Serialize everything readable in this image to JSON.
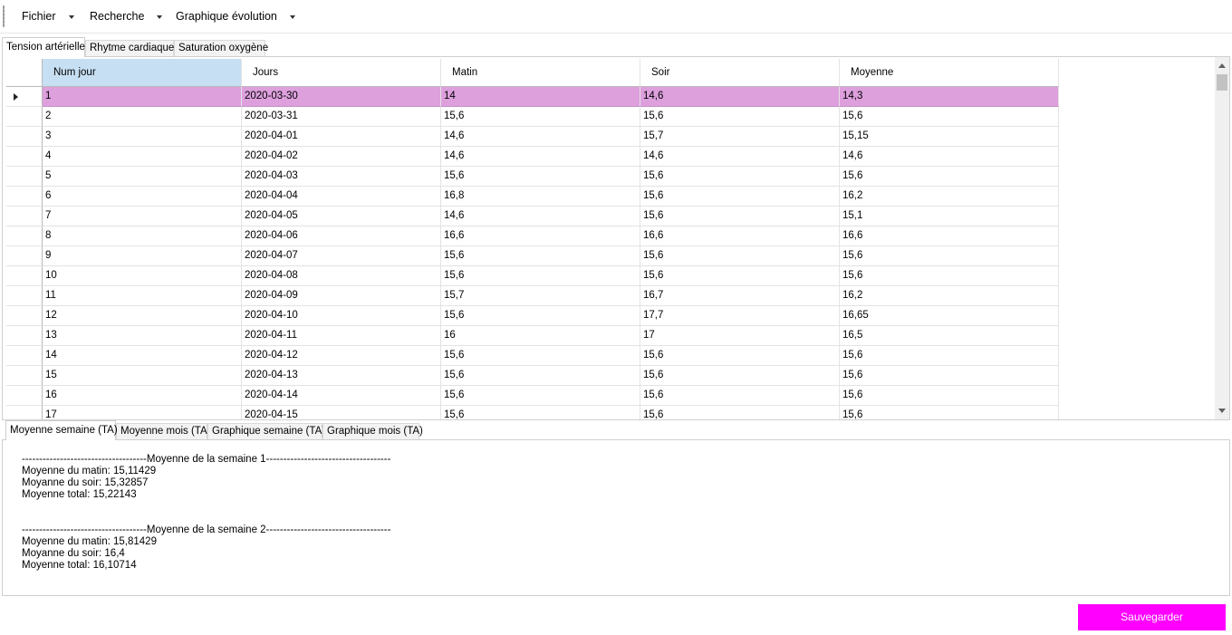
{
  "menu": {
    "items": [
      {
        "label": "Fichier"
      },
      {
        "label": "Recherche"
      },
      {
        "label": "Graphique évolution"
      }
    ]
  },
  "top_tabs": [
    {
      "label": "Tension artérielle",
      "active": true
    },
    {
      "label": "Rhytme cardiaque",
      "active": false
    },
    {
      "label": "Saturation oxygène",
      "active": false
    }
  ],
  "grid": {
    "columns": [
      "Num jour",
      "Jours",
      "Matin",
      "Soir",
      "Moyenne"
    ],
    "selected_column": "Num jour",
    "selected_row": 1,
    "rows": [
      [
        "1",
        "2020-03-30",
        "14",
        "14,6",
        "14,3"
      ],
      [
        "2",
        "2020-03-31",
        "15,6",
        "15,6",
        "15,6"
      ],
      [
        "3",
        "2020-04-01",
        "14,6",
        "15,7",
        "15,15"
      ],
      [
        "4",
        "2020-04-02",
        "14,6",
        "14,6",
        "14,6"
      ],
      [
        "5",
        "2020-04-03",
        "15,6",
        "15,6",
        "15,6"
      ],
      [
        "6",
        "2020-04-04",
        "16,8",
        "15,6",
        "16,2"
      ],
      [
        "7",
        "2020-04-05",
        "14,6",
        "15,6",
        "15,1"
      ],
      [
        "8",
        "2020-04-06",
        "16,6",
        "16,6",
        "16,6"
      ],
      [
        "9",
        "2020-04-07",
        "15,6",
        "15,6",
        "15,6"
      ],
      [
        "10",
        "2020-04-08",
        "15,6",
        "15,6",
        "15,6"
      ],
      [
        "11",
        "2020-04-09",
        "15,7",
        "16,7",
        "16,2"
      ],
      [
        "12",
        "2020-04-10",
        "15,6",
        "17,7",
        "16,65"
      ],
      [
        "13",
        "2020-04-11",
        "16",
        "17",
        "16,5"
      ],
      [
        "14",
        "2020-04-12",
        "15,6",
        "15,6",
        "15,6"
      ],
      [
        "15",
        "2020-04-13",
        "15,6",
        "15,6",
        "15,6"
      ],
      [
        "16",
        "2020-04-14",
        "15,6",
        "15,6",
        "15,6"
      ],
      [
        "17",
        "2020-04-15",
        "15,6",
        "15,6",
        "15,6"
      ]
    ]
  },
  "bottom_tabs": [
    {
      "label": "Moyenne semaine (TA)",
      "active": true
    },
    {
      "label": "Moyenne mois (TA)",
      "active": false
    },
    {
      "label": "Graphique semaine (TA)",
      "active": false
    },
    {
      "label": "Graphique mois (TA)",
      "active": false
    }
  ],
  "stats": {
    "week1": {
      "header": "------------------------------------Moyenne de la semaine 1------------------------------------",
      "matin": "Moyenne du matin: 15,11429",
      "soir": "Moyanne du soir: 15,32857",
      "total": "Moyenne total: 15,22143"
    },
    "week2": {
      "header": "------------------------------------Moyenne de la semaine 2------------------------------------",
      "matin": "Moyenne du matin: 15,81429",
      "soir": "Moyanne du soir: 16,4",
      "total": "Moyenne total: 16,10714"
    }
  },
  "save_label": "Sauvegarder",
  "colors": {
    "selected_row": "#dda0dd",
    "selected_header": "#c6dff3",
    "save_button": "#ff00ff"
  }
}
